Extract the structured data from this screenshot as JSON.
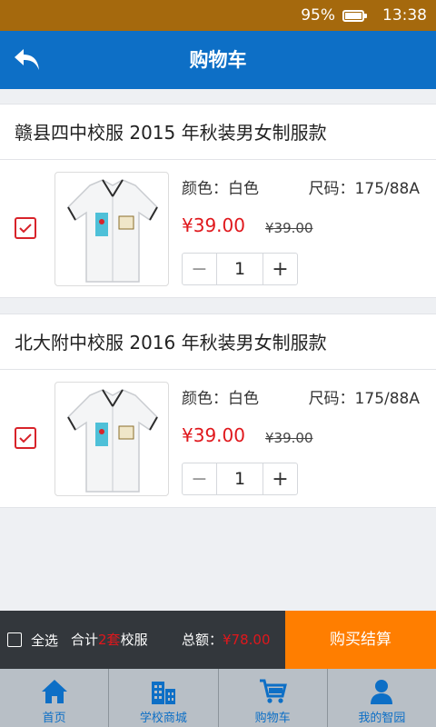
{
  "status_bar": {
    "battery": "95%",
    "time": "13:38"
  },
  "header": {
    "title": "购物车"
  },
  "cart": [
    {
      "store": "赣县四中校服  2015 年秋装男女制服款",
      "color": "颜色：白色",
      "size": "尺码：175/88A",
      "price": "¥39.00",
      "original_price": "¥39.00",
      "quantity": "1",
      "checked": true
    },
    {
      "store": "北大附中校服  2016 年秋装男女制服款",
      "color": "颜色：白色",
      "size": "尺码：175/88A",
      "price": "¥39.00",
      "original_price": "¥39.00",
      "quantity": "1",
      "checked": true
    }
  ],
  "checkout": {
    "select_all": "全选",
    "count_prefix": "合计",
    "count": "2套",
    "count_suffix": "校服",
    "total_label": "总额：",
    "total": "¥78.00",
    "pay_button": "购买结算"
  },
  "tabs": [
    {
      "label": "首页",
      "icon": "home-icon"
    },
    {
      "label": "学校商城",
      "icon": "building-icon"
    },
    {
      "label": "购物车",
      "icon": "cart-icon"
    },
    {
      "label": "我的智园",
      "icon": "user-icon"
    }
  ],
  "colors": {
    "primary": "#0d6fc6",
    "accent": "#ff7e00",
    "price": "#e0171c",
    "status_bar": "#a5690d"
  }
}
